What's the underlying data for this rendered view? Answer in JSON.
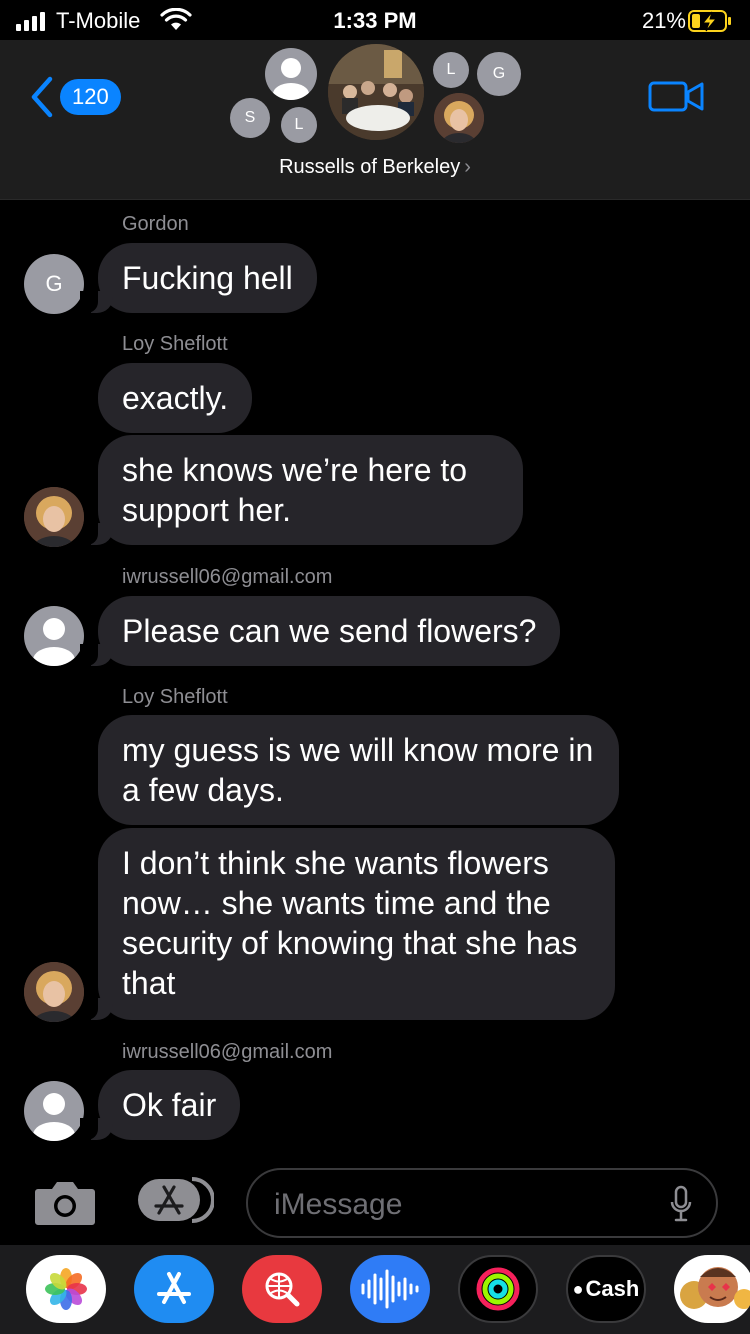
{
  "status_bar": {
    "carrier": "T-Mobile",
    "time": "1:33 PM",
    "battery": "21%"
  },
  "header": {
    "back_count": "120",
    "group_name": "Russells of Berkeley",
    "avatar_initials": {
      "s": "S",
      "l1": "L",
      "l2": "L",
      "g": "G"
    }
  },
  "messages": [
    {
      "sender": "Gordon",
      "avatar_initial": "G",
      "bubbles": [
        "Fucking hell"
      ]
    },
    {
      "sender": "Loy Sheflott",
      "bubbles": [
        "exactly.",
        "she knows we’re here to support her."
      ]
    },
    {
      "sender": "iwrussell06@gmail.com",
      "bubbles": [
        "Please can we send flowers?"
      ]
    },
    {
      "sender": "Loy Sheflott",
      "bubbles": [
        "my guess is we will know more in a few days.",
        "I don’t think she wants flowers now… she wants time and the security of knowing that she has that"
      ]
    },
    {
      "sender": "iwrussell06@gmail.com",
      "bubbles": [
        "Ok fair"
      ]
    }
  ],
  "input": {
    "placeholder": "iMessage"
  },
  "app_drawer": {
    "apps": [
      "photos-app",
      "app-store-app",
      "web-search-app",
      "audio-message-app",
      "fitness-activity-app",
      "apple-cash-app",
      "memoji-app"
    ],
    "cash_label": "Cash"
  },
  "colors": {
    "accent": "#0a84ff",
    "bubble": "#26252a",
    "background": "#000000",
    "header": "#1e1e1e"
  }
}
